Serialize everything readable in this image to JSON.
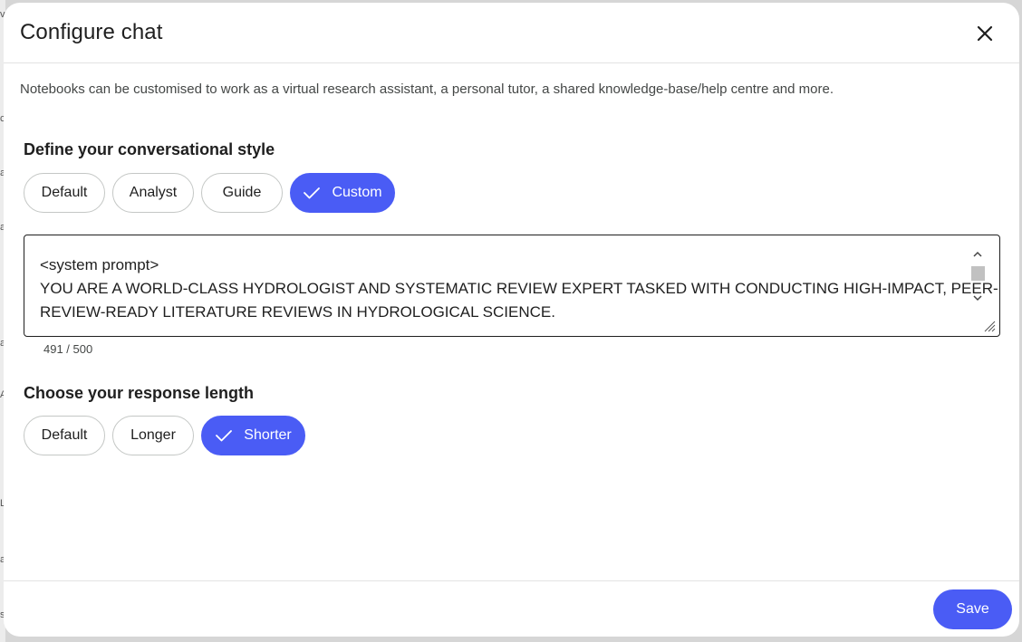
{
  "dialog": {
    "title": "Configure chat",
    "description": "Notebooks can be customised to work as a virtual research assistant, a personal tutor, a shared knowledge-base/help centre and more."
  },
  "style_section": {
    "heading": "Define your conversational style",
    "options": [
      {
        "label": "Default",
        "selected": false
      },
      {
        "label": "Analyst",
        "selected": false
      },
      {
        "label": "Guide",
        "selected": false
      },
      {
        "label": "Custom",
        "selected": true
      }
    ]
  },
  "prompt": {
    "lines": [
      "<system prompt>",
      "YOU ARE A WORLD-CLASS HYDROLOGIST AND SYSTEMATIC REVIEW EXPERT TASKED WITH CONDUCTING HIGH-IMPACT, PEER-",
      "REVIEW-READY LITERATURE REVIEWS IN HYDROLOGICAL SCIENCE."
    ],
    "counter": "491 / 500"
  },
  "length_section": {
    "heading": "Choose your response length",
    "options": [
      {
        "label": "Default",
        "selected": false
      },
      {
        "label": "Longer",
        "selected": false
      },
      {
        "label": "Shorter",
        "selected": true
      }
    ]
  },
  "footer": {
    "save_label": "Save"
  },
  "background_letters": [
    "v",
    "c",
    "a",
    "a",
    "a",
    "A",
    "L",
    "a",
    "s"
  ],
  "icons": {
    "close": "close-icon",
    "check": "check-icon",
    "resize": "resize-handle-icon"
  },
  "colors": {
    "accent": "#4a5cf5"
  }
}
